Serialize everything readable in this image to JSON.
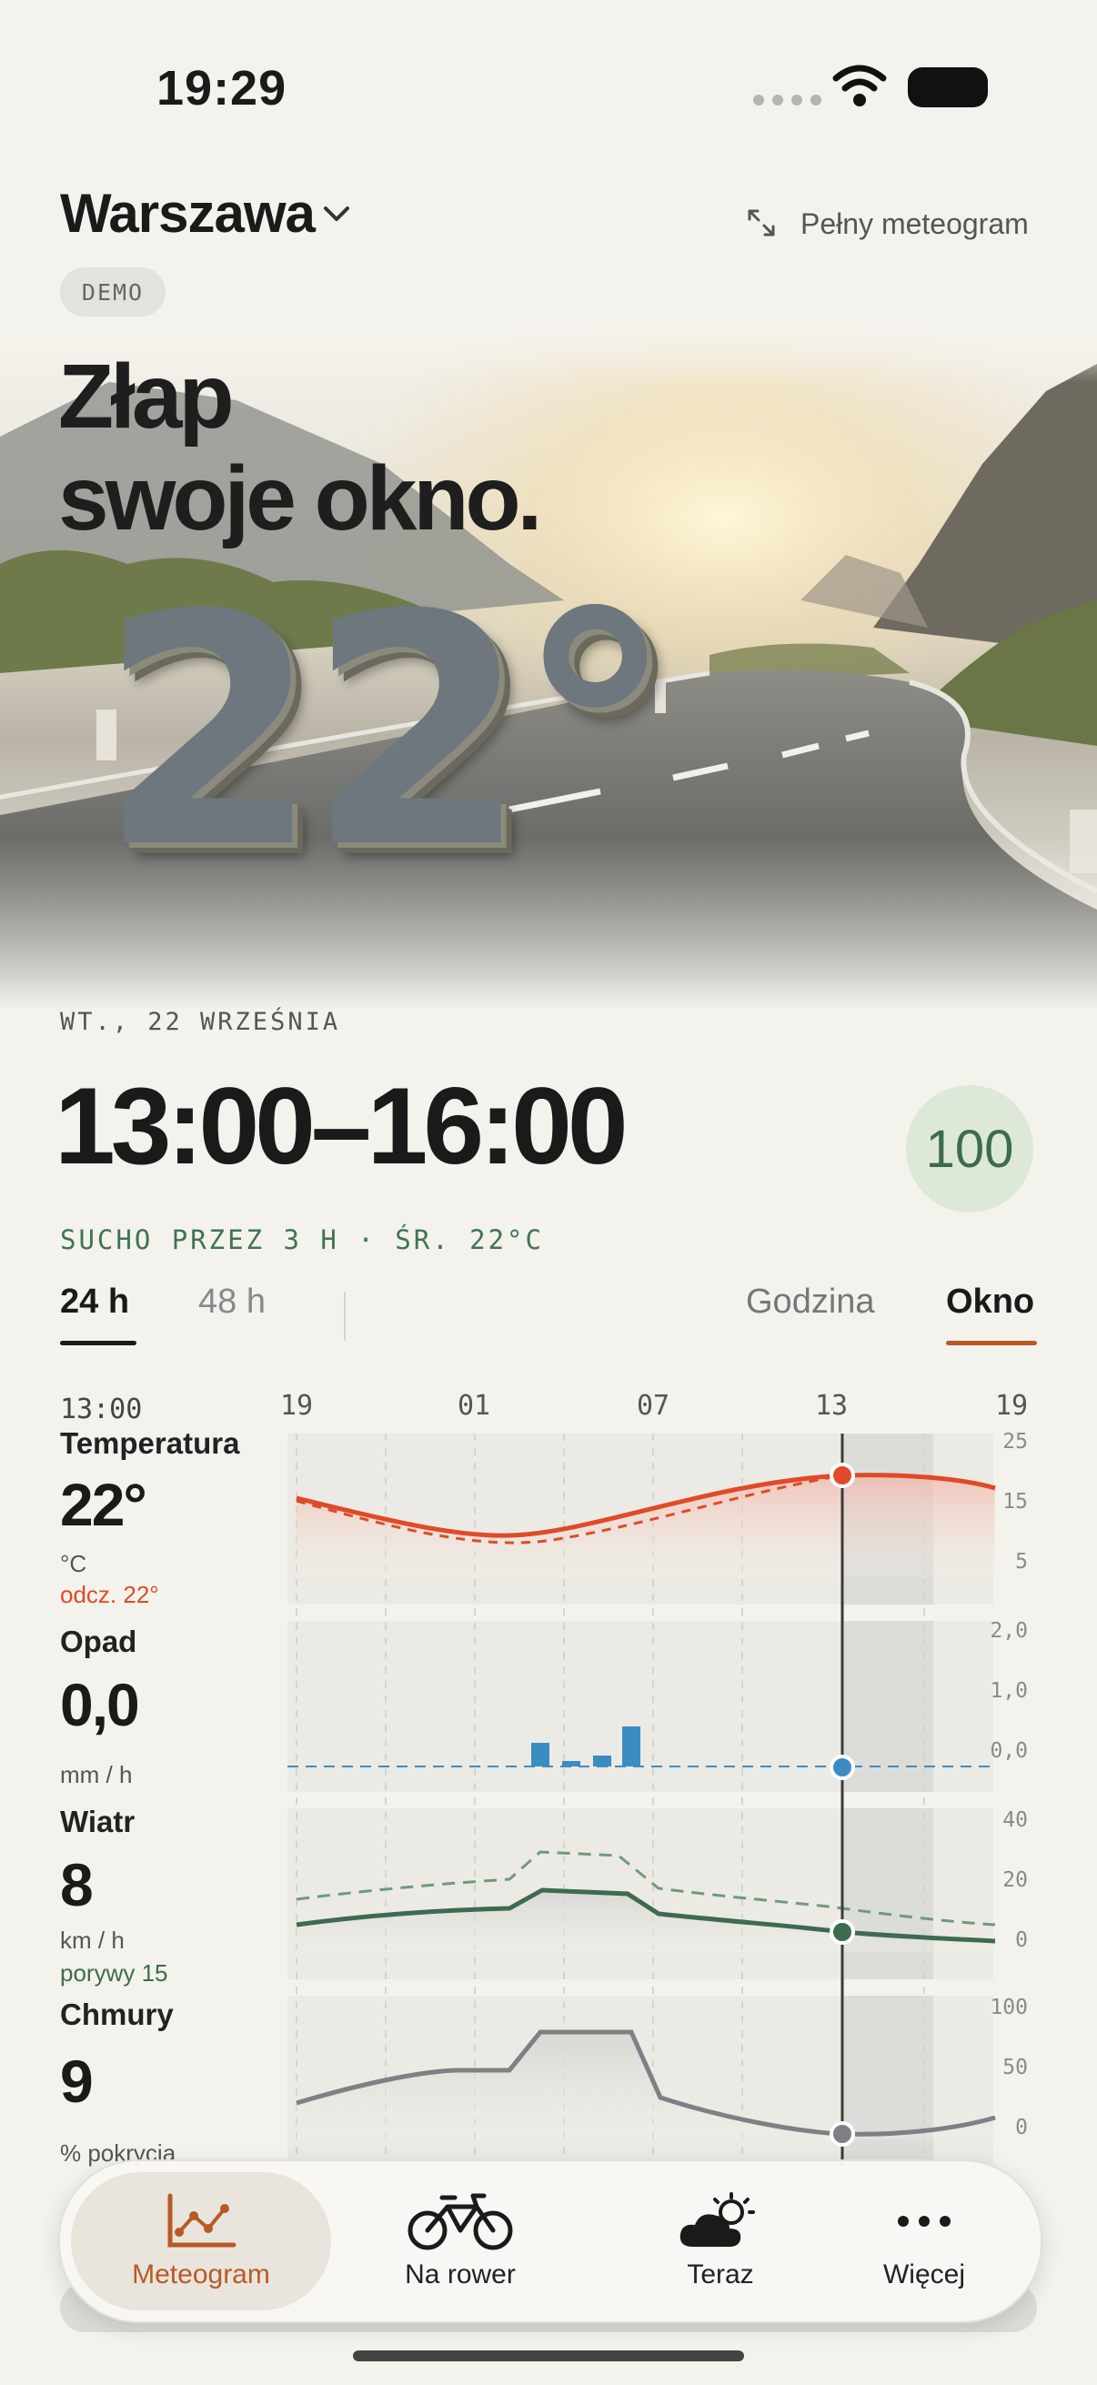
{
  "status_bar": {
    "time": "19:29"
  },
  "header": {
    "city": "Warszawa",
    "full_meteogram": "Pełny meteogram",
    "badge": "DEMO"
  },
  "hero": {
    "headline_line1": "Złap",
    "headline_line2": "swoje okno.",
    "temperature": "22°"
  },
  "window": {
    "date": "WT., 22 WRZEŚNIA",
    "time_range": "13:00–16:00",
    "score": "100",
    "summary": "SUCHO PRZEZ 3 H · ŚR. 22°C"
  },
  "tabs": {
    "range": [
      "24 h",
      "48 h"
    ],
    "mode": [
      "Godzina",
      "Okno"
    ],
    "active_range": "24 h",
    "active_mode": "Okno"
  },
  "meteogram": {
    "selected_hour": "13:00",
    "x_ticks": [
      "19",
      "01",
      "07",
      "13",
      "19"
    ],
    "temperature": {
      "title": "Temperatura",
      "value": "22°",
      "unit": "°C",
      "extra": "odcz. 22°",
      "y_ticks": [
        "25",
        "15",
        "5"
      ],
      "color": "#e04a28"
    },
    "precipitation": {
      "title": "Opad",
      "value": "0,0",
      "unit": "mm / h",
      "y_ticks": [
        "2,0",
        "1,0",
        "0,0"
      ],
      "color": "#3c8cc4"
    },
    "wind": {
      "title": "Wiatr",
      "value": "8",
      "unit": "km / h",
      "extra": "porywy 15",
      "y_ticks": [
        "40",
        "20",
        "0"
      ],
      "color": "#3d6b4f"
    },
    "clouds": {
      "title": "Chmury",
      "value": "9",
      "unit": "% pokrycia",
      "y_ticks": [
        "100",
        "50",
        "0"
      ],
      "color": "#7d8084"
    }
  },
  "nav": {
    "items": [
      "Meteogram",
      "Na rower",
      "Teraz",
      "Więcej"
    ],
    "active": "Meteogram",
    "accent": "#b85a26"
  }
}
